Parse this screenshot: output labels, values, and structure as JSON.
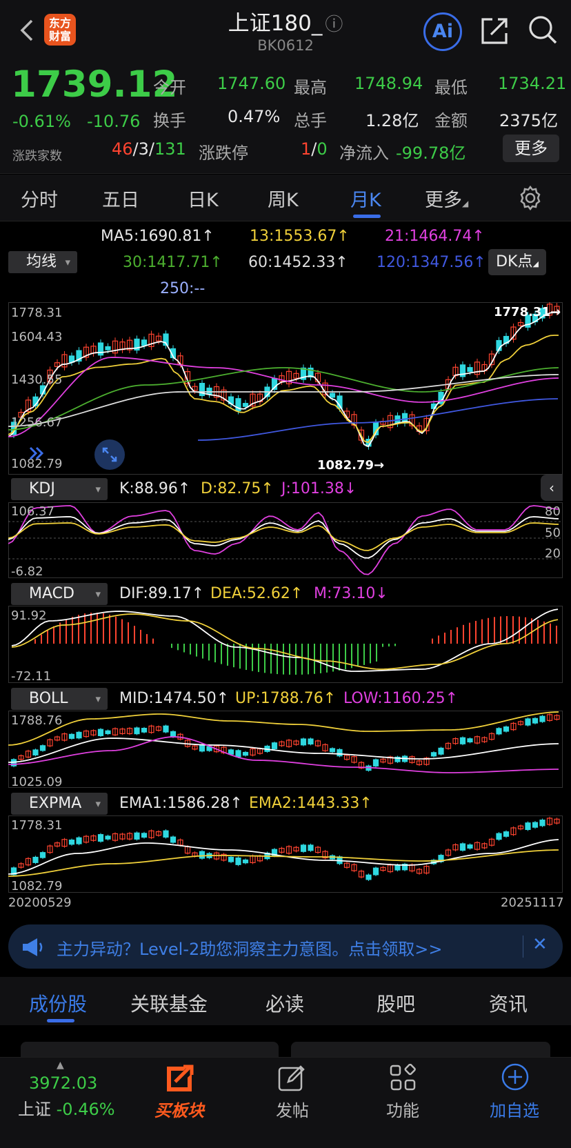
{
  "header": {
    "title": "上证180_",
    "info_icon": "ⓘ",
    "code": "BK0612",
    "logo_text": "东方财富",
    "ai_label": "Ai"
  },
  "quote": {
    "price": "1739.12",
    "change_pct": "-0.61%",
    "change": "-10.76",
    "open_label": "今开",
    "open": "1747.60",
    "high_label": "最高",
    "high": "1748.94",
    "low_label": "最低",
    "low": "1734.21",
    "turnover_label": "换手",
    "turnover": "0.47%",
    "vol_label": "总手",
    "volume": "1.28亿",
    "amount_label": "金额",
    "amount": "2375亿",
    "breadth_label": "涨跌家数",
    "up": "46",
    "flat": "3",
    "down": "131",
    "sep": "/",
    "limit_label": "涨跌停",
    "limit_up": "1",
    "limit_down": "0",
    "netflow_label": "净流入",
    "netflow": "-99.78亿",
    "more": "更多"
  },
  "tabs": [
    "分时",
    "五日",
    "日K",
    "周K",
    "月K",
    "更多"
  ],
  "ma": {
    "selector": "均线",
    "ma5": "MA5:1690.81↑",
    "ma13": "13:1553.67↑",
    "ma21": "21:1464.74↑",
    "ma30": "30:1417.71↑",
    "ma60": "60:1452.33↑",
    "ma120": "120:1347.56↑",
    "ma250": "250:--",
    "dk": "DK点"
  },
  "main_chart": {
    "y_labels": [
      "1778.31",
      "1604.43",
      "1430.55",
      "1256.67",
      "1082.79"
    ],
    "max_label": "1778.31→",
    "min_label": "1082.79→"
  },
  "kdj": {
    "name": "KDJ",
    "k": "K:88.96↑",
    "d": "D:82.75↑",
    "j": "J:101.38↓",
    "top": "106.37",
    "bottom": "-6.82",
    "levels": [
      "80",
      "50",
      "20"
    ]
  },
  "macd": {
    "name": "MACD",
    "dif": "DIF:89.17↑",
    "dea": "DEA:52.62↑",
    "m": "M:73.10↓",
    "top": "91.92",
    "bottom": "-72.11"
  },
  "boll": {
    "name": "BOLL",
    "mid": "MID:1474.50↑",
    "up": "UP:1788.76↑",
    "low": "LOW:1160.25↑",
    "top": "1788.76",
    "bottom": "1025.09"
  },
  "expma": {
    "name": "EXPMA",
    "ema1": "EMA1:1586.28↑",
    "ema2": "EMA2:1443.33↑",
    "top": "1778.31",
    "bottom": "1082.79"
  },
  "dates": {
    "start": "20200529",
    "end": "20251117"
  },
  "banner": {
    "text": "主力异动？Level-2助您洞察主力意图。点击领取>>"
  },
  "bottom_tabs": [
    "成份股",
    "关联基金",
    "必读",
    "股吧",
    "资讯"
  ],
  "nav": {
    "index_value": "3972.03",
    "index_name": "上证",
    "index_change": "-0.46%",
    "buy": "买板块",
    "post": "发帖",
    "func": "功能",
    "watch": "加自选"
  },
  "colors": {
    "up": "#ff4430",
    "down": "#3dcc48",
    "accent": "#3a6de8",
    "cyan_candle": "#2fd8e0"
  }
}
